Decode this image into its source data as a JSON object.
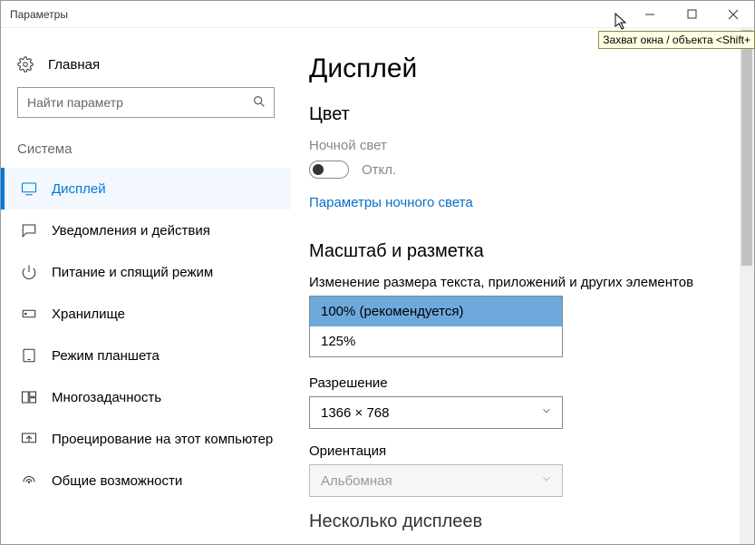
{
  "window": {
    "title": "Параметры"
  },
  "tooltip": "Захват окна / объекта <Shift+",
  "sidebar": {
    "home": "Главная",
    "search_placeholder": "Найти параметр",
    "group": "Система",
    "items": [
      {
        "label": "Дисплей",
        "active": true
      },
      {
        "label": "Уведомления и действия"
      },
      {
        "label": "Питание и спящий режим"
      },
      {
        "label": "Хранилище"
      },
      {
        "label": "Режим планшета"
      },
      {
        "label": "Многозадачность"
      },
      {
        "label": "Проецирование на этот компьютер"
      },
      {
        "label": "Общие возможности"
      }
    ]
  },
  "main": {
    "title": "Дисплей",
    "color_heading": "Цвет",
    "nightlight_label": "Ночной свет",
    "nightlight_state": "Откл.",
    "nightlight_link": "Параметры ночного света",
    "scale_heading": "Масштаб и разметка",
    "scale_label": "Изменение размера текста, приложений и других элементов",
    "scale_options": [
      "100% (рекомендуется)",
      "125%"
    ],
    "resolution_label": "Разрешение",
    "resolution_value": "1366 × 768",
    "orientation_label": "Ориентация",
    "orientation_value": "Альбомная",
    "multi_heading": "Несколько дисплеев"
  }
}
